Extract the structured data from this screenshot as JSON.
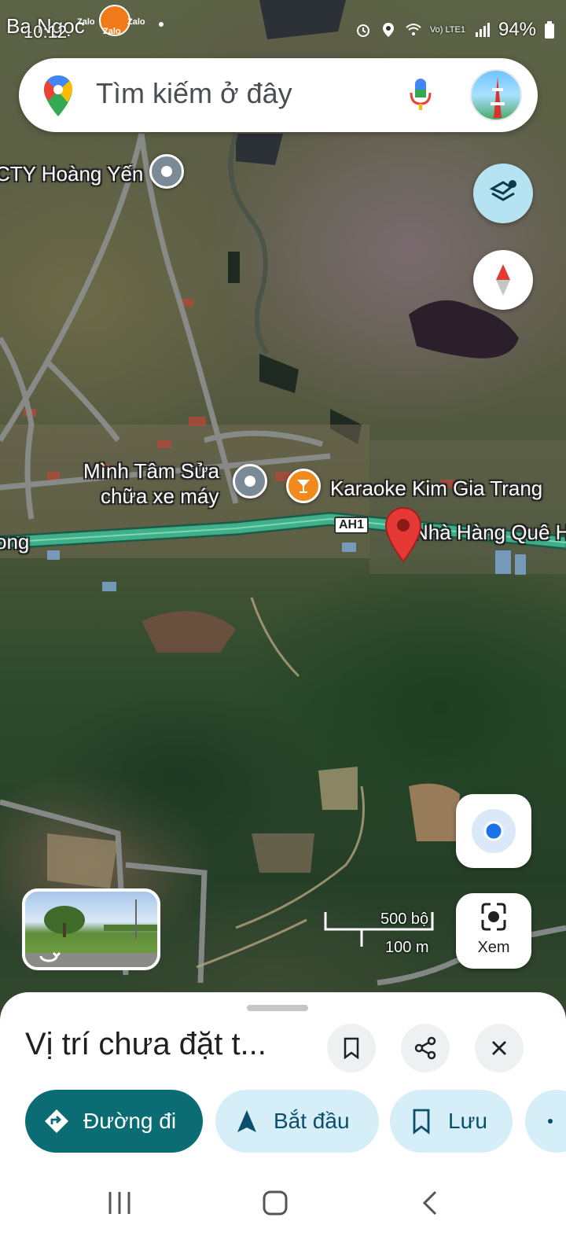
{
  "status_bar": {
    "carrier_overlay": "Ba Ngọc",
    "time": "10:12",
    "app_icons": [
      "Zalo",
      "Zalo",
      "Zalo"
    ],
    "battery": "94%",
    "network": "Vo) LTE1"
  },
  "search": {
    "placeholder": "Tìm kiếm ở đây"
  },
  "map": {
    "labels": {
      "cty_hoang_yen": "CTY Hoàng Yến",
      "minh_tam_line1": "Mình Tâm Sửa",
      "minh_tam_line2": "chữa xe máy",
      "karaoke": "Karaoke Kim Gia Trang",
      "nha_hang": "Nhà Hàng Quê H",
      "left_edge": "ong"
    },
    "road_shield": "AH1",
    "scale": {
      "imperial": "500 bộ",
      "metric": "100 m"
    },
    "colors": {
      "highway": "#3fb08a",
      "pin_red": "#e53935",
      "poi_gray": "#7a8a96",
      "poi_orange": "#f08a1c"
    }
  },
  "buttons": {
    "xem": "Xem"
  },
  "sheet": {
    "title": "Vị trí chưa đặt t...",
    "chips": {
      "directions": "Đường đi",
      "start": "Bắt đầu",
      "save": "Lưu"
    }
  },
  "icons": [
    "maps-logo-icon",
    "mic-icon",
    "layers-icon",
    "compass-icon",
    "my-location-icon",
    "camera-lens-icon",
    "bookmark-icon",
    "share-icon",
    "close-icon",
    "directions-icon",
    "navigation-arrow-icon",
    "recents-icon",
    "home-icon",
    "back-icon"
  ]
}
